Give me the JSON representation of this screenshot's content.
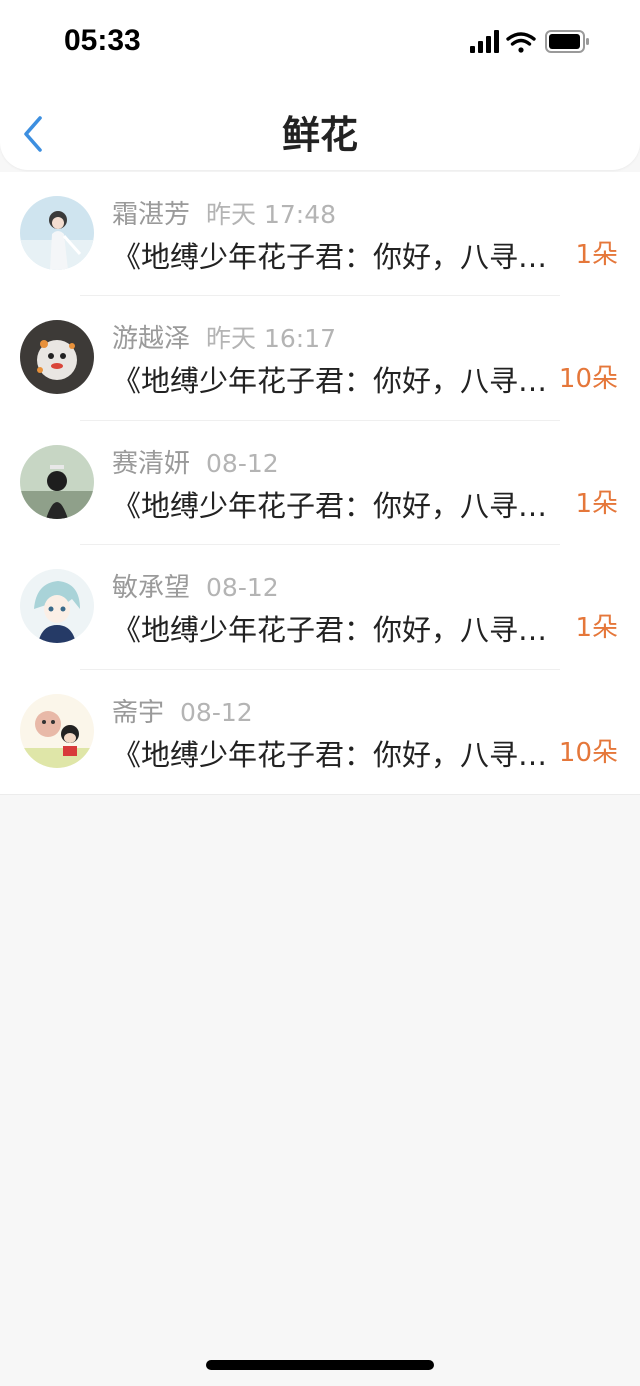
{
  "status_bar": {
    "time": "05:33",
    "icons": [
      "signal-icon",
      "wifi-icon",
      "battery-icon"
    ]
  },
  "nav": {
    "title": "鲜花",
    "back_icon": "chevron-left-icon"
  },
  "colors": {
    "accent": "#e5773a",
    "back": "#3d8fe0",
    "name": "#9a9a9a",
    "message": "#222222"
  },
  "items": [
    {
      "name": "霜湛芳",
      "time": "昨天 17:48",
      "message": "《地缚少年花子君：你好，八寻宁宁》",
      "count": "1朵"
    },
    {
      "name": "游越泽",
      "time": "昨天 16:17",
      "message": "《地缚少年花子君：你好，八寻宁宁》",
      "count": "10朵"
    },
    {
      "name": "赛清妍",
      "time": "08-12",
      "message": "《地缚少年花子君：你好，八寻宁宁》",
      "count": "1朵"
    },
    {
      "name": "敏承望",
      "time": "08-12",
      "message": "《地缚少年花子君：你好，八寻宁宁》",
      "count": "1朵"
    },
    {
      "name": "斋宇",
      "time": "08-12",
      "message": "《地缚少年花子君：你好，八寻宁宁》",
      "count": "10朵"
    }
  ]
}
